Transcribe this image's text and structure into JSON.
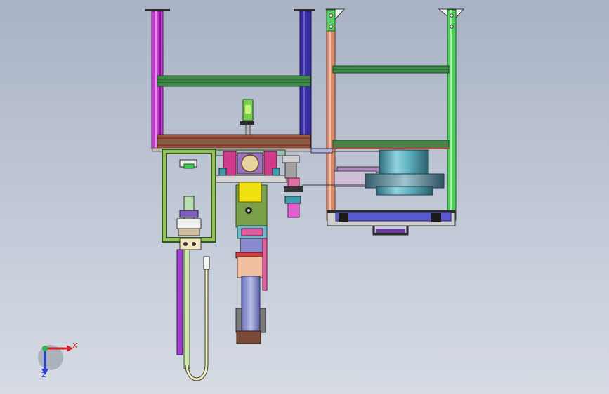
{
  "viewport": {
    "background_top": "#a9b3c6",
    "background_bottom": "#d6dbe4"
  },
  "triad": {
    "x_label": "X",
    "y_label": "Z",
    "x_color": "#d8202a",
    "y_color": "#2a3ed8",
    "origin_color": "#2fb34a"
  },
  "colors": {
    "frame_magenta": "#c23ad0",
    "frame_indigo": "#3b2fa0",
    "frame_salmon": "#d98a6a",
    "frame_green": "#4fd05a",
    "rail_green": "#3f8a4a",
    "rail_brown": "#9a5540",
    "plate_green": "#7aa04a",
    "yellow": "#f0e010",
    "cylinder_cyan": "#60b8c8",
    "pink": "#e0409a"
  }
}
